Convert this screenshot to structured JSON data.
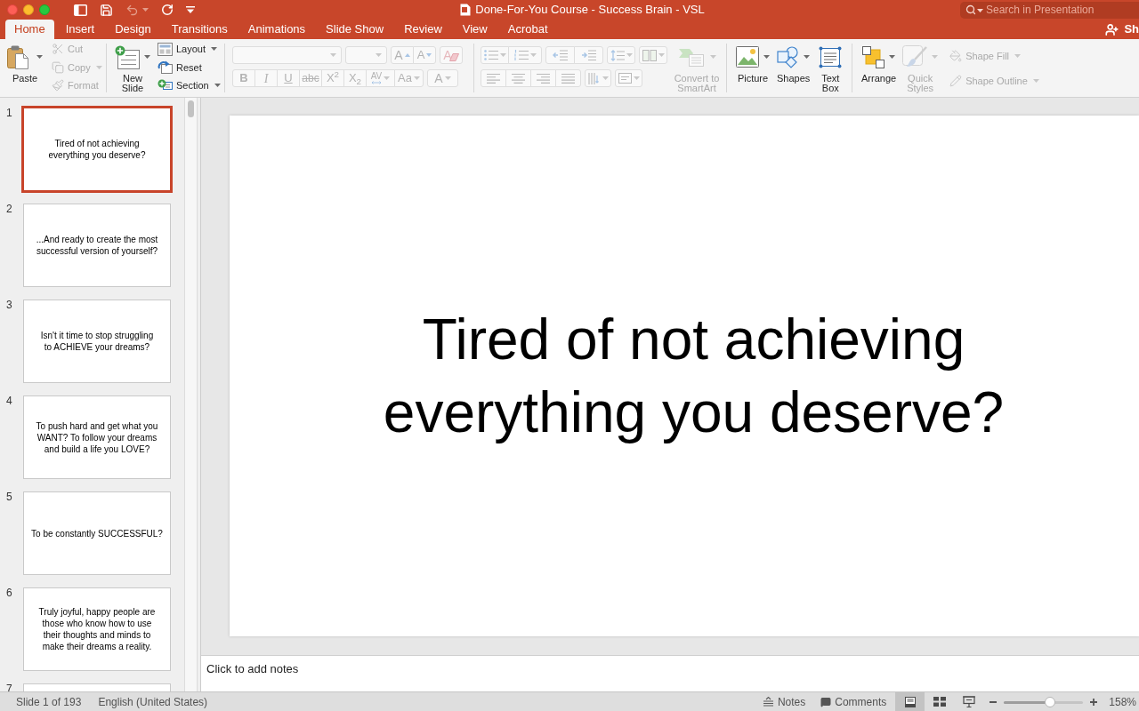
{
  "window": {
    "title": "Done-For-You Course - Success Brain - VSL"
  },
  "quick_access": [
    {
      "kind": "sidebar",
      "disabled": false,
      "dropdown": false
    },
    {
      "kind": "save",
      "disabled": false,
      "dropdown": false
    },
    {
      "kind": "undo",
      "disabled": true,
      "dropdown": true
    },
    {
      "kind": "redo",
      "disabled": false,
      "dropdown": false
    },
    {
      "kind": "customize",
      "disabled": false,
      "dropdown": false
    }
  ],
  "search": {
    "placeholder": "Search in Presentation"
  },
  "tabs": [
    {
      "label": "Home",
      "selected": true
    },
    {
      "label": "Insert",
      "selected": false
    },
    {
      "label": "Design",
      "selected": false
    },
    {
      "label": "Transitions",
      "selected": false
    },
    {
      "label": "Animations",
      "selected": false
    },
    {
      "label": "Slide Show",
      "selected": false
    },
    {
      "label": "Review",
      "selected": false
    },
    {
      "label": "View",
      "selected": false
    },
    {
      "label": "Acrobat",
      "selected": false
    }
  ],
  "share": {
    "label": "Sh"
  },
  "ribbon": {
    "clipboard": {
      "paste": {
        "label": "Paste",
        "dropdown": true
      },
      "tools": [
        {
          "kind": "cut",
          "label": "Cut",
          "disabled": true,
          "dropdown": false
        },
        {
          "kind": "copy",
          "label": "Copy",
          "disabled": true,
          "dropdown": true
        },
        {
          "kind": "format",
          "label": "Format",
          "disabled": true,
          "dropdown": false
        }
      ]
    },
    "slides": {
      "new_slide": {
        "label": "New Slide",
        "dropdown": true
      },
      "tools": [
        {
          "kind": "layout",
          "label": "Layout",
          "dropdown": true
        },
        {
          "kind": "reset",
          "label": "Reset",
          "dropdown": false
        },
        {
          "kind": "section",
          "label": "Section",
          "dropdown": true
        }
      ]
    },
    "font": {
      "disabled": true,
      "row_1": [
        [
          {
            "kind": "grow",
            "label": "A"
          },
          {
            "kind": "shrink",
            "label": "A"
          }
        ],
        [
          {
            "kind": "clear",
            "label": "A"
          }
        ]
      ],
      "row_2": [
        [
          {
            "kind": "bold",
            "label": "B"
          },
          {
            "kind": "italic",
            "label": "I"
          },
          {
            "kind": "underline",
            "label": "U"
          },
          {
            "kind": "strikethrough",
            "label": "abc"
          },
          {
            "kind": "superscript",
            "label": "X$^{2}$"
          },
          {
            "kind": "subscript",
            "label": "X$_{2}$"
          },
          {
            "kind": "spacing",
            "label": "AV"
          },
          {
            "kind": "case",
            "label": "Aa"
          }
        ],
        [
          {
            "kind": "color",
            "label": "A"
          }
        ]
      ]
    },
    "paragraph": {
      "disabled": true,
      "row_1": [
        [
          {
            "kind": "bullets",
            "dropdown": true
          },
          {
            "kind": "numbering",
            "dropdown": true
          }
        ],
        [
          {
            "kind": "outdent",
            "dropdown": false
          },
          {
            "kind": "indent",
            "dropdown": false
          }
        ],
        [
          {
            "kind": "line_spacing",
            "dropdown": true
          }
        ],
        [
          {
            "kind": "columns",
            "dropdown": true
          }
        ]
      ],
      "row_2": [
        [
          {
            "kind": "align_left",
            "dropdown": false
          },
          {
            "kind": "align_center",
            "dropdown": false
          },
          {
            "kind": "align_right",
            "dropdown": false
          },
          {
            "kind": "justify",
            "dropdown": false
          }
        ],
        [
          {
            "kind": "text_direction",
            "dropdown": true
          }
        ],
        [
          {
            "kind": "align_text",
            "dropdown": true
          }
        ]
      ],
      "smartart": {
        "label": "Convert to SmartArt",
        "disabled": true,
        "dropdown": true
      }
    },
    "insert": [
      {
        "kind": "picture",
        "label": "Picture",
        "dropdown": true
      },
      {
        "kind": "shapes",
        "label": "Shapes",
        "dropdown": true
      },
      {
        "kind": "text_box",
        "label": "Text Box",
        "dropdown": false
      }
    ],
    "drawing": {
      "tools": [
        {
          "kind": "arrange",
          "label": "Arrange",
          "disabled": false,
          "dropdown": true
        },
        {
          "kind": "quick_styles",
          "label": "Quick Styles",
          "disabled": true,
          "dropdown": true
        }
      ],
      "shape_format": [
        {
          "kind": "fill",
          "label": "Shape Fill",
          "disabled": true,
          "dropdown": true
        },
        {
          "kind": "outline",
          "label": "Shape Outline",
          "disabled": true,
          "dropdown": true
        }
      ]
    }
  },
  "slides": [
    {
      "number": "1",
      "lines": [
        "Tired of not achieving",
        "everything you deserve?"
      ],
      "selected": true
    },
    {
      "number": "2",
      "lines": [
        "...And ready to create the most",
        "successful version of yourself?"
      ],
      "selected": false
    },
    {
      "number": "3",
      "lines": [
        "Isn't it time to stop struggling",
        "to ACHIEVE your dreams?"
      ],
      "selected": false
    },
    {
      "number": "4",
      "lines": [
        "To push hard and get what you",
        "WANT? To follow your dreams",
        "and build a life you LOVE?"
      ],
      "selected": false
    },
    {
      "number": "5",
      "lines": [
        "To be constantly SUCCESSFUL?"
      ],
      "selected": false
    },
    {
      "number": "6",
      "lines": [
        "Truly joyful, happy people are",
        "those who know how to use",
        "their thoughts and minds to",
        "make their dreams a reality."
      ],
      "selected": false
    },
    {
      "number": "7",
      "selected": false
    }
  ],
  "slide": {
    "lines": [
      "Tired of not achieving",
      "everything you deserve?"
    ]
  },
  "notes": {
    "placeholder": "Click to add notes"
  },
  "status_bar": {
    "slide_position": "Slide 1 of 193",
    "language": "English (United States)",
    "notes_button": "Notes",
    "comments_button": "Comments",
    "views": [
      {
        "kind": "normal",
        "selected": true
      },
      {
        "kind": "sorter",
        "selected": false
      },
      {
        "kind": "presenter",
        "selected": false
      }
    ],
    "zoom": {
      "level": 0.58,
      "reading": "158%"
    }
  }
}
